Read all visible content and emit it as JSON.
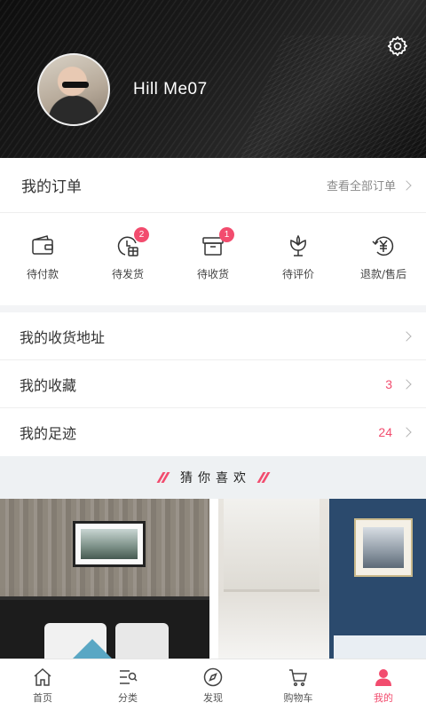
{
  "header": {
    "username": "Hill Me07",
    "settings_icon": "gear-icon"
  },
  "orders": {
    "title": "我的订单",
    "view_all": "查看全部订单",
    "items": [
      {
        "label": "待付款",
        "icon": "wallet-icon",
        "badge": null
      },
      {
        "label": "待发货",
        "icon": "gift-clock-icon",
        "badge": "2"
      },
      {
        "label": "待收货",
        "icon": "box-icon",
        "badge": "1"
      },
      {
        "label": "待评价",
        "icon": "flower-icon",
        "badge": null
      },
      {
        "label": "退款/售后",
        "icon": "yen-refresh-icon",
        "badge": null
      }
    ]
  },
  "list": [
    {
      "label": "我的收货地址",
      "count": ""
    },
    {
      "label": "我的收藏",
      "count": "3"
    },
    {
      "label": "我的足迹",
      "count": "24"
    }
  ],
  "guess": {
    "title": "猜你喜欢"
  },
  "tabs": [
    {
      "label": "首页",
      "icon": "home-icon",
      "active": false
    },
    {
      "label": "分类",
      "icon": "category-icon",
      "active": false
    },
    {
      "label": "发现",
      "icon": "compass-icon",
      "active": false
    },
    {
      "label": "购物车",
      "icon": "cart-icon",
      "active": false
    },
    {
      "label": "我的",
      "icon": "user-icon",
      "active": true
    }
  ],
  "colors": {
    "accent": "#f24c6e",
    "header_bg": "#151515",
    "page_bg": "#f3f4f6"
  }
}
